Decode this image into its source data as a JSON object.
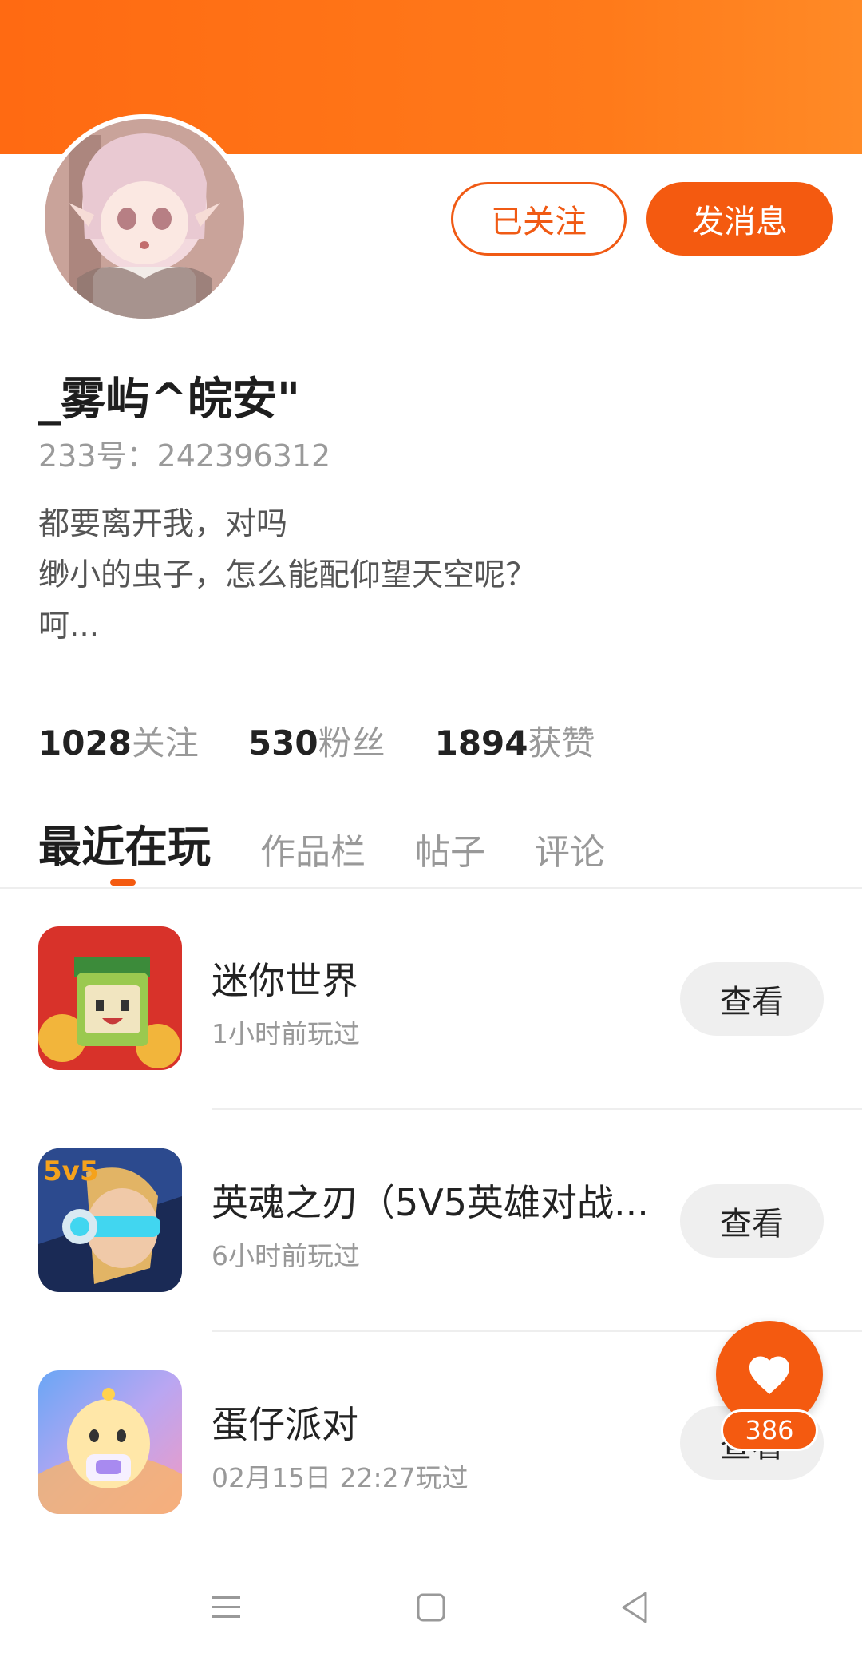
{
  "profile": {
    "username": "_雾屿^皖安\"",
    "user_id": "233号：242396312",
    "bio_lines": [
      "都要离开我，对吗",
      "缈小的虫子，怎么能配仰望天空呢？",
      "呵..."
    ],
    "follow_button": "已关注",
    "message_button": "发消息"
  },
  "stats": [
    {
      "num": "1028",
      "label": "关注"
    },
    {
      "num": "530",
      "label": "粉丝"
    },
    {
      "num": "1894",
      "label": "获赞"
    }
  ],
  "tabs": [
    {
      "label": "最近在玩",
      "active": true
    },
    {
      "label": "作品栏",
      "active": false
    },
    {
      "label": "帖子",
      "active": false
    },
    {
      "label": "评论",
      "active": false
    }
  ],
  "games": [
    {
      "title": "迷你世界",
      "subtitle": "1小时前玩过",
      "button": "查看"
    },
    {
      "title": "英魂之刃（5V5英雄对战...",
      "subtitle": "6小时前玩过",
      "button": "查看"
    },
    {
      "title": "蛋仔派对",
      "subtitle": "02月15日 22:27玩过",
      "button": "查看"
    }
  ],
  "like": {
    "count": "386"
  },
  "icons": {
    "like": "heart-icon",
    "nav_menu": "menu-icon",
    "nav_home": "square-icon",
    "nav_back": "back-triangle-icon"
  },
  "colors": {
    "accent": "#f45a10",
    "header": "#ff7a1a"
  }
}
